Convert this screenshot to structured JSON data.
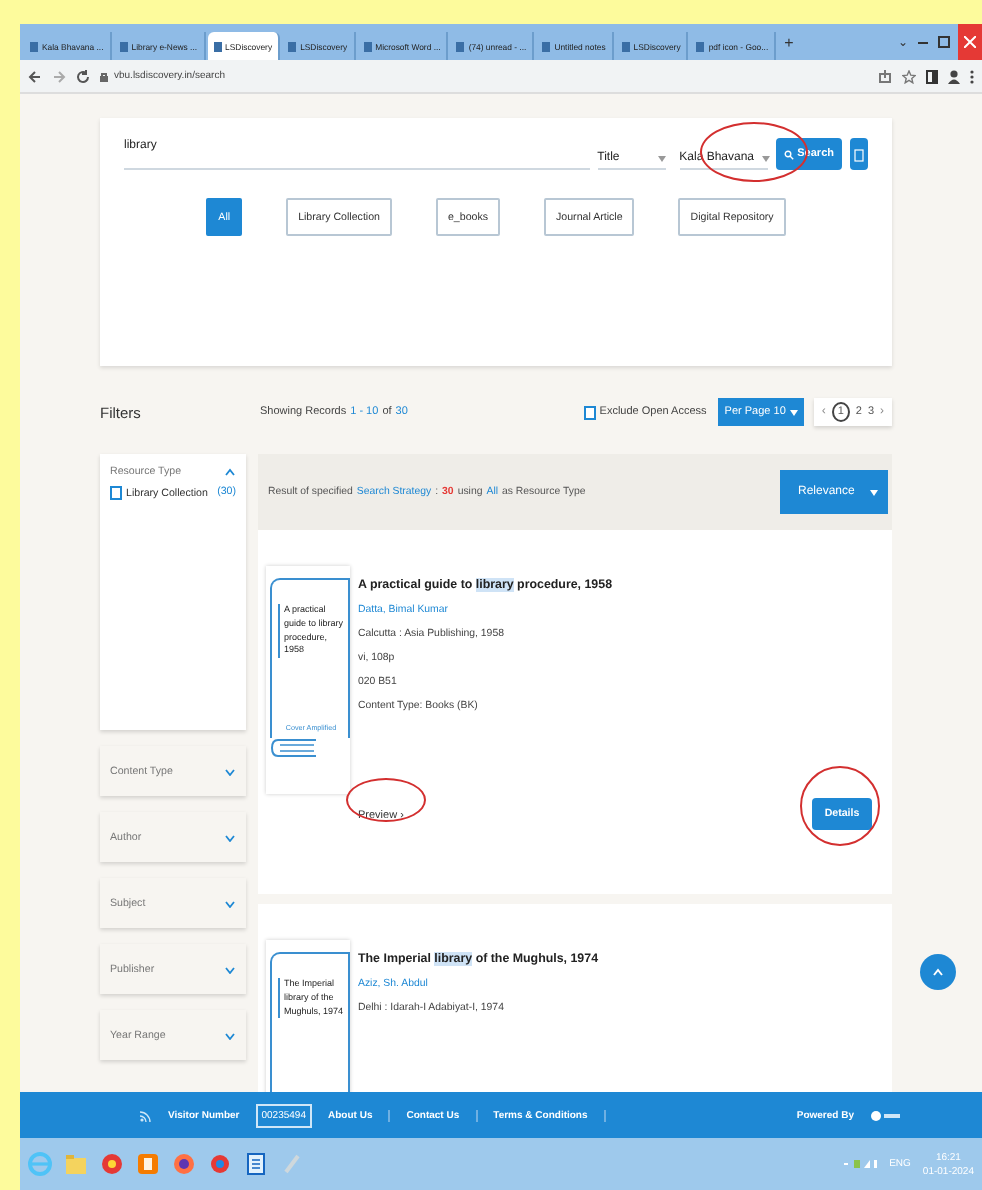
{
  "browser": {
    "tabs": [
      {
        "title": "Kala Bhavana ...",
        "selected": false
      },
      {
        "title": "Library e-News ...",
        "selected": false
      },
      {
        "title": "LSDiscovery",
        "selected": true
      },
      {
        "title": "LSDiscovery",
        "selected": false
      },
      {
        "title": "Microsoft Word ...",
        "selected": false
      },
      {
        "title": "(74) unread - ...",
        "selected": false
      },
      {
        "title": "Untitled notes",
        "selected": false
      },
      {
        "title": "LSDiscovery",
        "selected": false
      },
      {
        "title": "pdf icon - Goo...",
        "selected": false
      }
    ],
    "new_tab": "+",
    "tab_menu": "⌄",
    "address": "vbu.lsdiscovery.in/search"
  },
  "search": {
    "query": "library",
    "field": "Title",
    "scope": "Kala Bhavana",
    "button": "Search",
    "types": [
      {
        "label": "All",
        "selected": true
      },
      {
        "label": "Library Collection",
        "selected": false
      },
      {
        "label": "e_books",
        "selected": false
      },
      {
        "label": "Journal Article",
        "selected": false
      },
      {
        "label": "Digital Repository",
        "selected": false
      }
    ]
  },
  "filters_heading": "Filters",
  "records": [
    {
      "text": "Showing Records",
      "kind": "plain"
    },
    {
      "text": "1 - 10",
      "kind": "link"
    },
    {
      "text": "of",
      "kind": "plain"
    },
    {
      "text": "30",
      "kind": "link"
    }
  ],
  "exclude_open_access": {
    "label": "Exclude Open Access",
    "checked": false
  },
  "per_page": "Per Page 10",
  "pagination": {
    "prev": "‹",
    "pages": [
      {
        "label": "1",
        "selected": true
      },
      {
        "label": "2",
        "selected": false
      },
      {
        "label": "3",
        "selected": false
      }
    ],
    "next": "›"
  },
  "facets": [
    {
      "title": "Resource Type",
      "expanded": true,
      "options": [
        {
          "label": "Library Collection",
          "count": "(30)",
          "checked": false
        }
      ]
    },
    {
      "title": "Content Type",
      "expanded": false
    },
    {
      "title": "Author",
      "expanded": false
    },
    {
      "title": "Subject",
      "expanded": false
    },
    {
      "title": "Publisher",
      "expanded": false
    },
    {
      "title": "Year Range",
      "expanded": false
    }
  ],
  "strategy": [
    {
      "text": "Result of specified",
      "kind": "plain"
    },
    {
      "text": "Search Strategy",
      "kind": "link"
    },
    {
      "text": ":",
      "kind": "plain"
    },
    {
      "text": "30",
      "kind": "count"
    },
    {
      "text": "using",
      "kind": "plain"
    },
    {
      "text": "All",
      "kind": "link"
    },
    {
      "text": "as Resource Type",
      "kind": "plain"
    }
  ],
  "sort": "Relevance",
  "results": [
    {
      "cover": "A practical guide to library procedure, 1958",
      "cover_note": "Cover Amplified",
      "title": [
        {
          "text": "A practical guide to ",
          "highlight": false
        },
        {
          "text": "library",
          "highlight": true
        },
        {
          "text": " procedure, 1958",
          "highlight": false
        }
      ],
      "author": "Datta, Bimal Kumar",
      "lines": [
        "Calcutta : Asia Publishing, 1958",
        "vi, 108p",
        "020 B51",
        "Content Type: Books (BK)"
      ],
      "preview": "Preview",
      "preview_arrow": "›",
      "details": "Details"
    },
    {
      "cover": "The Imperial library of the Mughuls, 1974",
      "title": [
        {
          "text": "The Imperial ",
          "highlight": false
        },
        {
          "text": "library",
          "highlight": true
        },
        {
          "text": " of the Mughuls, 1974",
          "highlight": false
        }
      ],
      "author": "Aziz, Sh. Abdul",
      "lines": [
        "Delhi : Idarah-I Adabiyat-I, 1974"
      ]
    }
  ],
  "footer": {
    "visitor_label": "Visitor Number",
    "visitor_count": "00235494",
    "links": [
      "About Us",
      "Contact Us",
      "Terms & Conditions"
    ],
    "powered_by": "Powered By"
  },
  "taskbar": {
    "language": "ENG",
    "time": "16:21",
    "date": "01-01-2024"
  }
}
